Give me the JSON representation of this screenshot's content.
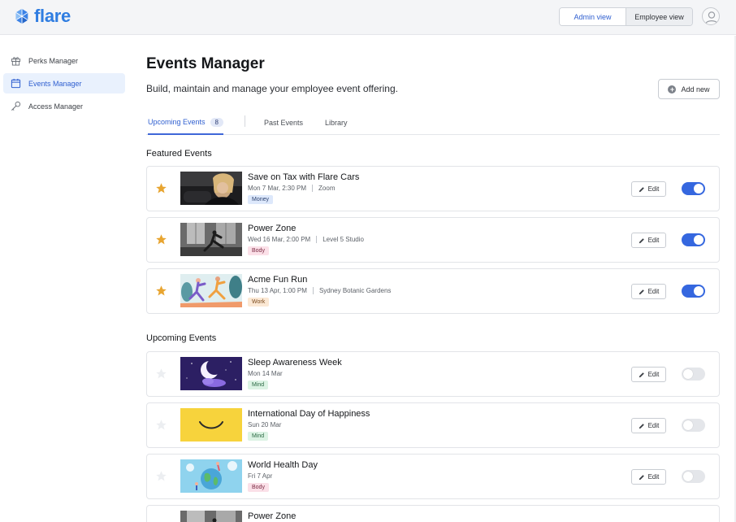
{
  "header": {
    "logo_text": "flare",
    "admin_view_label": "Admin view",
    "employee_view_label": "Employee view",
    "avatar_icon": "user-avatar-icon"
  },
  "sidebar": {
    "items": [
      {
        "label": "Perks Manager",
        "icon": "gift-icon",
        "active": false
      },
      {
        "label": "Events Manager",
        "icon": "calendar-icon",
        "active": true
      },
      {
        "label": "Access Manager",
        "icon": "key-icon",
        "active": false
      }
    ]
  },
  "main": {
    "title": "Events Manager",
    "subtitle": "Build, maintain and manage your employee event offering.",
    "add_new_label": "Add new",
    "tabs": [
      {
        "label": "Upcoming Events",
        "count": "8",
        "active": true
      },
      {
        "label": "Past Events",
        "active": false
      },
      {
        "label": "Library",
        "active": false
      }
    ],
    "featured_title": "Featured Events",
    "upcoming_title": "Upcoming Events",
    "edit_label": "Edit",
    "featured_events": [
      {
        "title": "Save on Tax with Flare Cars",
        "date": "Mon 7 Mar, 2:30 PM",
        "location": "Zoom",
        "tag": "Money",
        "enabled": true,
        "featured": true
      },
      {
        "title": "Power Zone",
        "date": "Wed 16 Mar, 2:00 PM",
        "location": "Level 5 Studio",
        "tag": "Body",
        "enabled": true,
        "featured": true
      },
      {
        "title": "Acme Fun Run",
        "date": "Thu 13 Apr, 1:00 PM",
        "location": "Sydney Botanic Gardens",
        "tag": "Work",
        "enabled": true,
        "featured": true
      }
    ],
    "upcoming_events": [
      {
        "title": "Sleep Awareness Week",
        "date": "Mon 14 Mar",
        "tag": "Mind",
        "enabled": false,
        "featured": false
      },
      {
        "title": "International Day of Happiness",
        "date": "Sun 20 Mar",
        "tag": "Mind",
        "enabled": false,
        "featured": false
      },
      {
        "title": "World Health Day",
        "date": "Fri 7 Apr",
        "tag": "Body",
        "enabled": false,
        "featured": false
      },
      {
        "title": "Power Zone",
        "enabled": false,
        "featured": false
      }
    ]
  },
  "colors": {
    "accent": "#3567df",
    "star_active": "#e8a531",
    "star_inactive": "#e9ebee"
  }
}
